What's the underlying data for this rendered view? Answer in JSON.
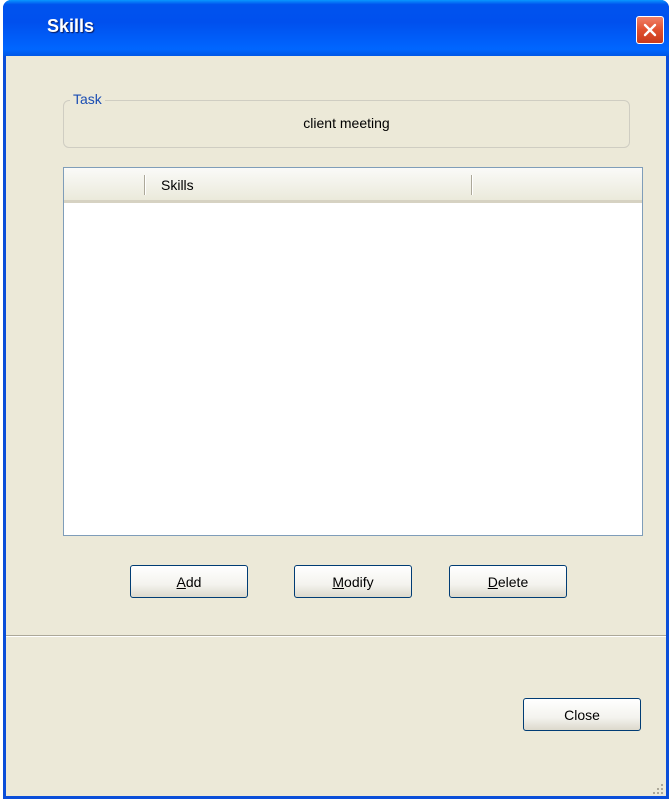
{
  "window": {
    "title": "Skills",
    "close_icon": "close-icon"
  },
  "task": {
    "legend": "Task",
    "value": "client meeting"
  },
  "skills_list": {
    "columns": [
      "",
      "Skills",
      ""
    ],
    "rows": []
  },
  "buttons": {
    "add": {
      "accel": "A",
      "rest": "dd"
    },
    "modify": {
      "accel": "M",
      "rest": "odify"
    },
    "delete": {
      "accel": "D",
      "rest": "elete"
    },
    "close": "Close"
  },
  "colors": {
    "title_bar": "#0054e3",
    "dialog_bg": "#ece9d8",
    "legend_text": "#1a4db3",
    "close_button": "#e0502f"
  }
}
